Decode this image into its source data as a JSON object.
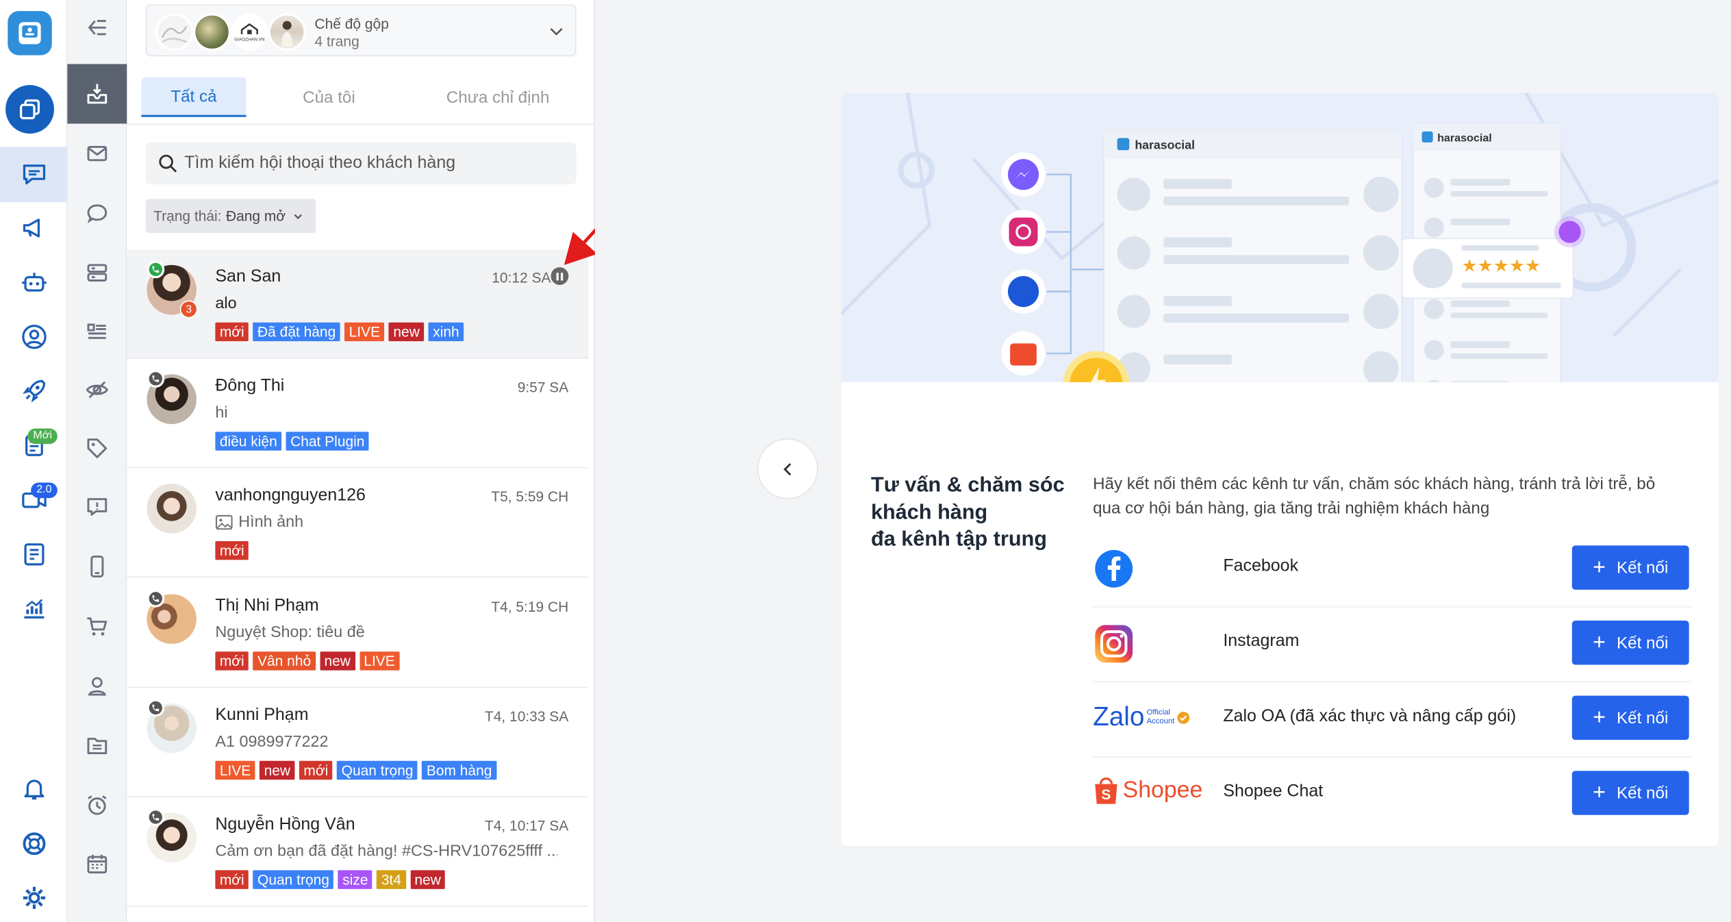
{
  "rail": {
    "new_badge": "Mới",
    "version_badge": "2.0"
  },
  "page_selector": {
    "title": "Chế độ gộp",
    "subtitle": "4 trang",
    "page_avatar_text": "GIAOZHAN.VN"
  },
  "tabs": [
    {
      "label": "Tất cả",
      "active": true
    },
    {
      "label": "Của tôi",
      "active": false
    },
    {
      "label": "Chưa chỉ định",
      "active": false
    }
  ],
  "search": {
    "placeholder": "Tìm kiếm hội thoại theo khách hàng"
  },
  "status_filter": {
    "label": "Trạng thái:",
    "value": "Đang mở"
  },
  "conversations": [
    {
      "name": "San San",
      "time": "10:12 SA",
      "message": "alo",
      "unread": "3",
      "tags": [
        {
          "t": "mới",
          "c": "#d1372b"
        },
        {
          "t": "Đã đặt hàng",
          "c": "#3b82f6"
        },
        {
          "t": "LIVE",
          "c": "#ef5a2f"
        },
        {
          "t": "new",
          "c": "#c1272d"
        },
        {
          "t": "xinh",
          "c": "#3b82f6"
        }
      ]
    },
    {
      "name": "Đông Thi",
      "time": "9:57 SA",
      "message": "hi",
      "tags": [
        {
          "t": "điều kiện",
          "c": "#3b82f6"
        },
        {
          "t": "Chat Plugin",
          "c": "#3b82f6"
        }
      ]
    },
    {
      "name": "vanhongnguyen126",
      "time": "T5, 5:59 CH",
      "message": "Hình ảnh",
      "tags": [
        {
          "t": "mới",
          "c": "#d1372b"
        }
      ]
    },
    {
      "name": "Thị Nhi Phạm",
      "time": "T4, 5:19 CH",
      "message": "Nguyệt Shop: tiêu đề",
      "tags": [
        {
          "t": "mới",
          "c": "#d1372b"
        },
        {
          "t": "Vân nhỏ",
          "c": "#e8542b"
        },
        {
          "t": "new",
          "c": "#c1272d"
        },
        {
          "t": "LIVE",
          "c": "#ef5a2f"
        }
      ]
    },
    {
      "name": "Kunni Phạm",
      "time": "T4, 10:33 SA",
      "message": "A1 0989977222",
      "tags": [
        {
          "t": "LIVE",
          "c": "#ef5a2f"
        },
        {
          "t": "new",
          "c": "#c1272d"
        },
        {
          "t": "mới",
          "c": "#d1372b"
        },
        {
          "t": "Quan trọng",
          "c": "#3b82f6"
        },
        {
          "t": "Bom hàng",
          "c": "#3b82f6"
        }
      ]
    },
    {
      "name": "Nguyễn Hồng Vân",
      "time": "T4, 10:17 SA",
      "message": "Cảm ơn bạn đã đặt hàng! #CS-HRV107625ffff ...",
      "tags": [
        {
          "t": "mới",
          "c": "#d1372b"
        },
        {
          "t": "Quan trọng",
          "c": "#3b82f6"
        },
        {
          "t": "size",
          "c": "#a855f7"
        },
        {
          "t": "3t4",
          "c": "#d4a017"
        },
        {
          "t": "new",
          "c": "#c1272d"
        }
      ]
    }
  ],
  "promo": {
    "illustration_brand": "harasocial",
    "title_lines": [
      "Tư vấn & chăm sóc",
      "khách hàng",
      "đa kênh tập trung"
    ],
    "description": "Hãy kết nối thêm các kênh tư vấn, chăm sóc khách hàng, tránh trả lời trễ, bỏ qua cơ hội bán hàng, gia tăng trải nghiệm khách hàng",
    "connect_label": "Kết nối",
    "channels": [
      {
        "name": "Facebook",
        "icon": "facebook-icon"
      },
      {
        "name": "Instagram",
        "icon": "instagram-icon"
      },
      {
        "name": "Zalo OA (đã xác thực và nâng cấp gói)",
        "icon": "zalo-oa-logo",
        "logo_text": "Zalo",
        "logo_sub1": "Official",
        "logo_sub2": "Account"
      },
      {
        "name": "Shopee Chat",
        "icon": "shopee-logo",
        "logo_text": "Shopee"
      }
    ]
  },
  "colors": {
    "primary": "#2563eb",
    "rail_active": "#dde6f7",
    "tab_active": "#1f6fd0"
  }
}
